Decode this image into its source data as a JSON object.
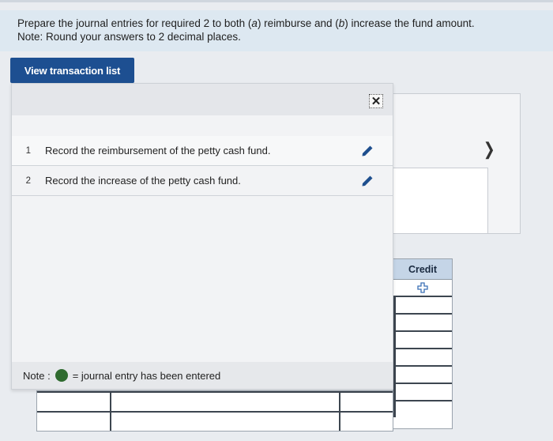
{
  "instructions": {
    "line1_a": "Prepare the journal entries for required 2 to both (",
    "line1_a_letter": "a",
    "line1_b": ") reimburse and (",
    "line1_b_letter": "b",
    "line1_c": ") increase the fund amount.",
    "line2": "Note: Round your answers to 2 decimal places."
  },
  "view_button": {
    "label": "View transaction list"
  },
  "modal": {
    "close_icon": "close-icon",
    "transactions": [
      {
        "num": "1",
        "text": "Record the reimbursement of the petty cash fund."
      },
      {
        "num": "2",
        "text": "Record the increase of the petty cash fund."
      }
    ],
    "note": {
      "prefix": "Note :",
      "suffix": "= journal entry has been entered",
      "dot_color": "#2f6b2f"
    }
  },
  "journal": {
    "credit_header": "Credit",
    "add_icon": "plus-icon",
    "next_icon": "chevron-right-icon"
  },
  "colors": {
    "button": "#1d4f91",
    "instruction_band": "#dde8f1",
    "credit_header": "#c5d5e7",
    "pencil": "#1e4f8e"
  }
}
